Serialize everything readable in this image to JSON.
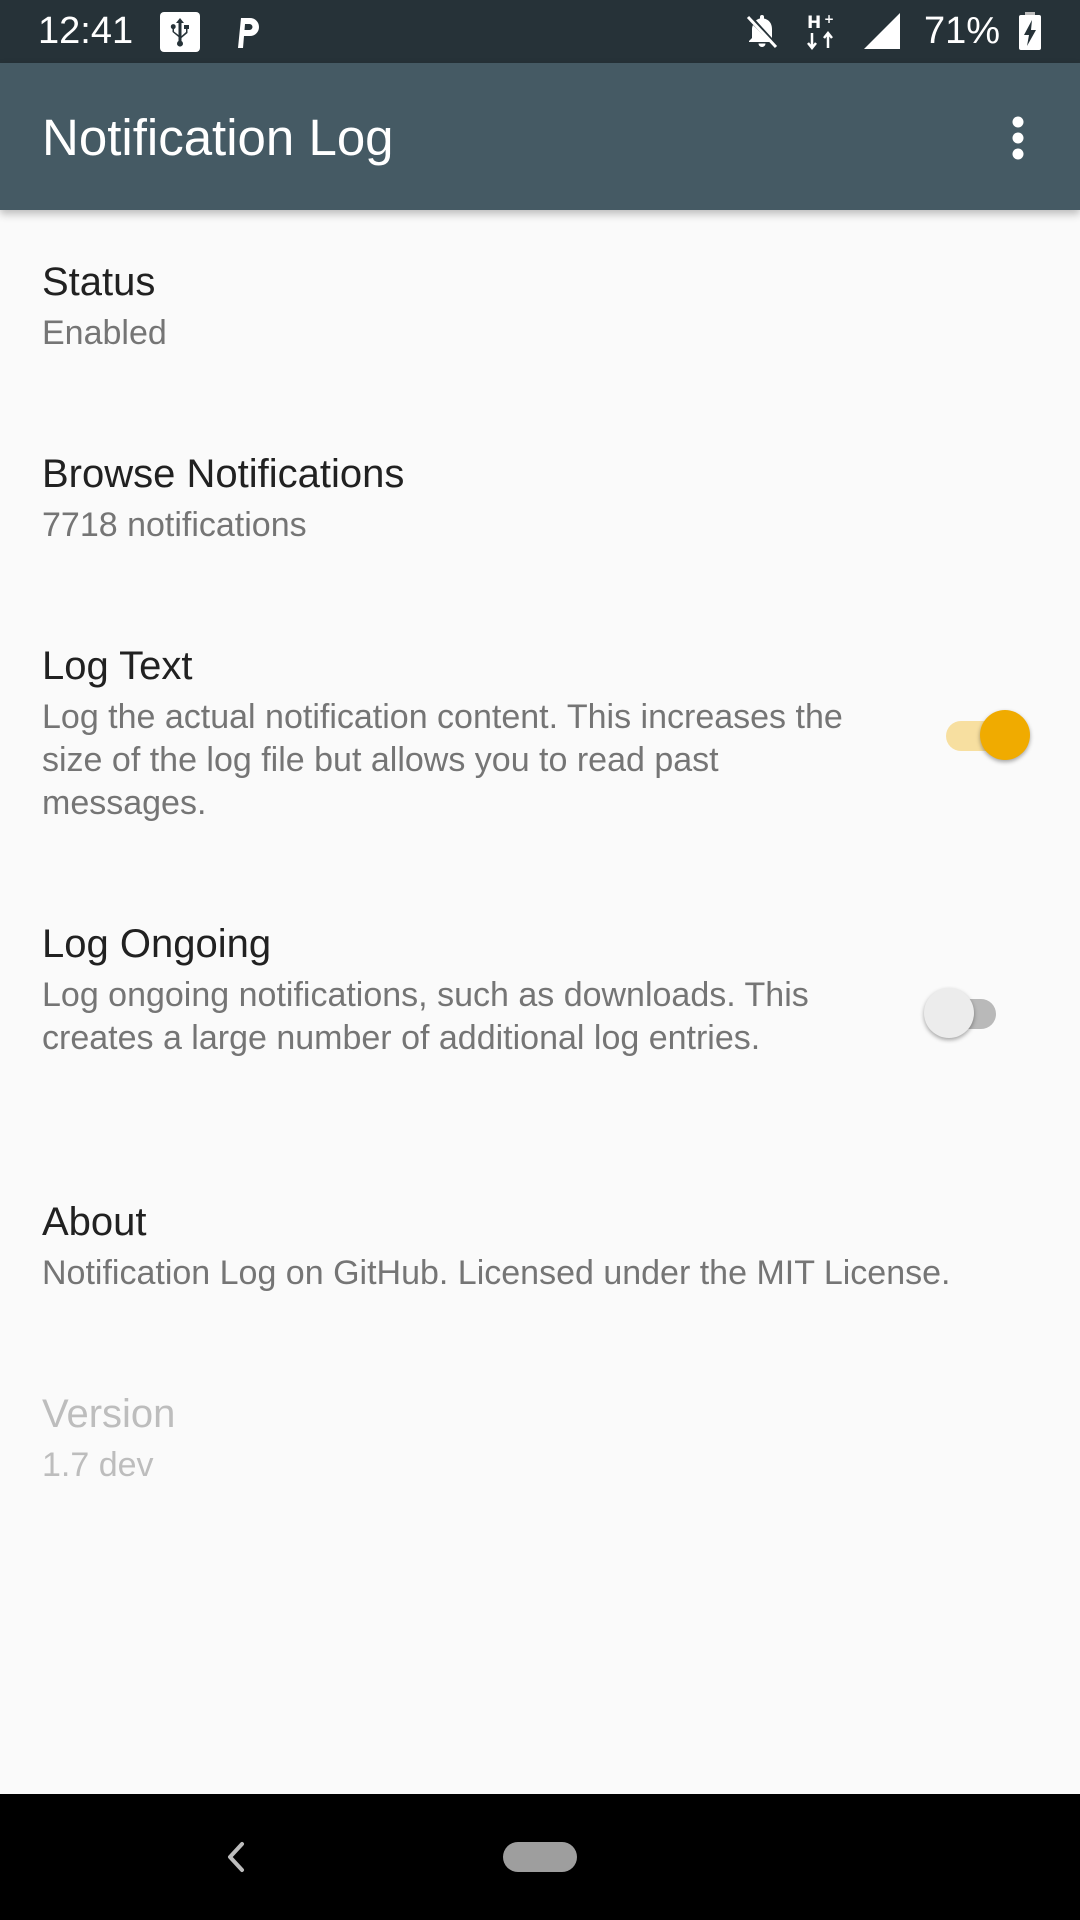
{
  "status_bar": {
    "time": "12:41",
    "battery": "71%",
    "icons": [
      "usb-icon",
      "parking-app-icon",
      "notifications-off-icon",
      "h-plus-data-icon",
      "signal-icon",
      "battery-charging-icon"
    ]
  },
  "app_bar": {
    "title": "Notification Log",
    "menu_icon": "more-vert-icon"
  },
  "preferences": {
    "status": {
      "title": "Status",
      "summary": "Enabled"
    },
    "browse": {
      "title": "Browse Notifications",
      "summary": "7718 notifications"
    },
    "log_text": {
      "title": "Log Text",
      "summary": "Log the actual notification content. This increases the size of the log file but allows you to read past messages.",
      "enabled": true
    },
    "log_ongoing": {
      "title": "Log Ongoing",
      "summary": "Log ongoing notifications, such as downloads. This creates a large number of additional log entries.",
      "enabled": false
    },
    "about": {
      "title": "About",
      "summary": "Notification Log on GitHub. Licensed under the MIT License."
    },
    "version": {
      "title": "Version",
      "summary": "1.7 dev"
    }
  },
  "colors": {
    "status_bar": "#263238",
    "app_bar": "#455a64",
    "accent": "#f0ab00",
    "background": "#fafafa"
  },
  "nav_bar": {
    "icons": [
      "back-icon",
      "home-pill-icon"
    ]
  }
}
